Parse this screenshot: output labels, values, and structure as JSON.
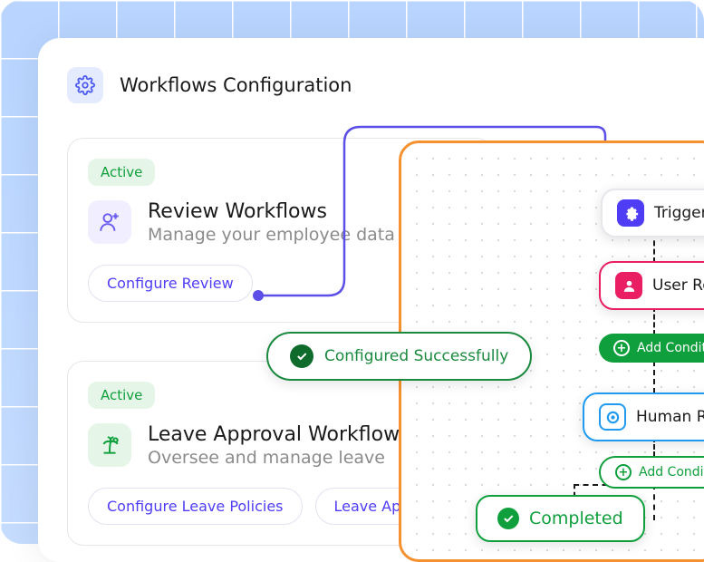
{
  "header": {
    "title": "Workflows Configuration"
  },
  "cards": [
    {
      "badge": "Active",
      "title": "Review Workflows",
      "subtitle": "Manage your employee data",
      "buttons": [
        "Configure Review"
      ]
    },
    {
      "badge": "Active",
      "title": "Leave Approval Workflow",
      "subtitle": "Oversee and manage leave",
      "buttons": [
        "Configure Leave Policies",
        "Leave Approval"
      ]
    }
  ],
  "toast": {
    "message": "Configured Successfully"
  },
  "nodes": {
    "trigger": "Trigger",
    "userRole": "User Role",
    "humanResource": "Human Resource (",
    "completed": "Completed",
    "addCondition": "Add Condition"
  },
  "colors": {
    "accent": "#4F3DF5",
    "success": "#0F9F3C",
    "canvasBorder": "#F59130",
    "pink": "#E91E63",
    "blue": "#1E9BF0"
  }
}
